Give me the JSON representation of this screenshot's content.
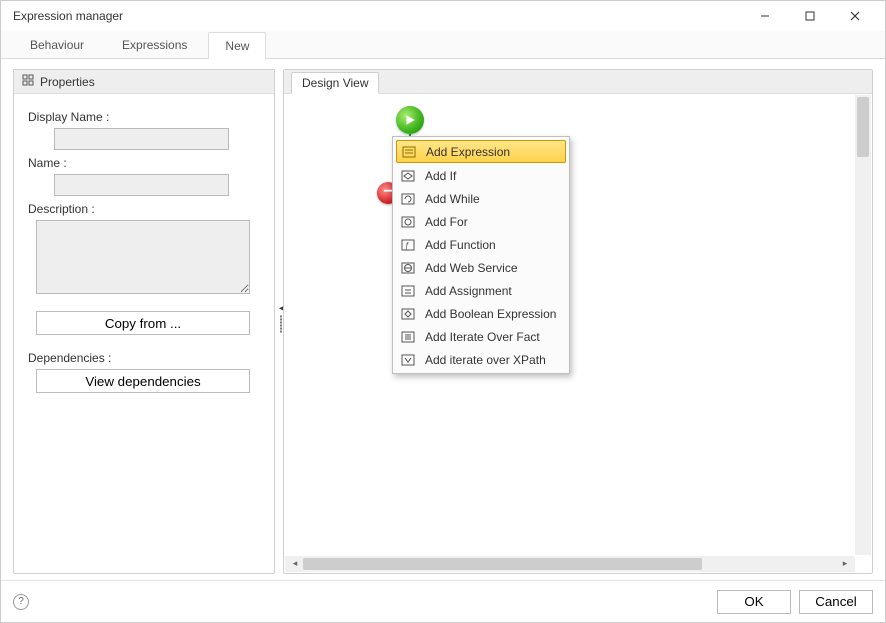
{
  "window": {
    "title": "Expression manager"
  },
  "tabs": {
    "items": [
      "Behaviour",
      "Expressions",
      "New"
    ],
    "active_index": 2
  },
  "left": {
    "header": "Properties",
    "display_name_label": "Display Name :",
    "display_name_value": "",
    "name_label": "Name :",
    "name_value": "",
    "description_label": "Description :",
    "description_value": "",
    "copy_button": "Copy from ...",
    "dependencies_label": "Dependencies :",
    "view_deps_button": "View dependencies"
  },
  "right": {
    "header_tab": "Design View"
  },
  "context_menu": {
    "items": [
      {
        "label": "Add Expression",
        "icon": "expression-icon",
        "selected": true
      },
      {
        "label": "Add If",
        "icon": "if-icon"
      },
      {
        "label": "Add While",
        "icon": "while-icon"
      },
      {
        "label": "Add For",
        "icon": "for-icon"
      },
      {
        "label": "Add Function",
        "icon": "function-icon"
      },
      {
        "label": "Add Web Service",
        "icon": "webservice-icon"
      },
      {
        "label": "Add Assignment",
        "icon": "assignment-icon"
      },
      {
        "label": "Add Boolean Expression",
        "icon": "boolean-icon"
      },
      {
        "label": "Add Iterate Over Fact",
        "icon": "iterate-fact-icon"
      },
      {
        "label": "Add iterate over XPath",
        "icon": "iterate-xpath-icon"
      }
    ]
  },
  "footer": {
    "ok": "OK",
    "cancel": "Cancel"
  }
}
